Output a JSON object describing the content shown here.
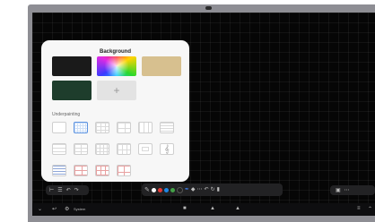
{
  "background_panel": {
    "title": "Background",
    "swatches": [
      {
        "name": "black",
        "color": "#1a1a1a"
      },
      {
        "name": "color-spectrum"
      },
      {
        "name": "tan",
        "color": "#d7c08f"
      },
      {
        "name": "dark-green",
        "color": "#1e3d2c"
      },
      {
        "name": "add",
        "label": "+"
      }
    ],
    "underpainting_label": "Underpainting",
    "selected_underpainting": 1
  },
  "left_toolbar": {
    "icons": [
      "expand-icon",
      "list-icon",
      "undo-icon",
      "redo-icon"
    ]
  },
  "center_toolbar": {
    "colors": [
      "#ffffff",
      "#e53935",
      "#1e88e5",
      "#43a047",
      "#212121"
    ],
    "icons": [
      "pen-icon",
      "brush-icon",
      "eraser-icon",
      "select-icon",
      "undo-icon",
      "redo-icon",
      "trash-icon"
    ]
  },
  "right_toolbar": {
    "icons": [
      "page-icon",
      "more-icon"
    ]
  },
  "taskbar": {
    "system_label": "System"
  }
}
